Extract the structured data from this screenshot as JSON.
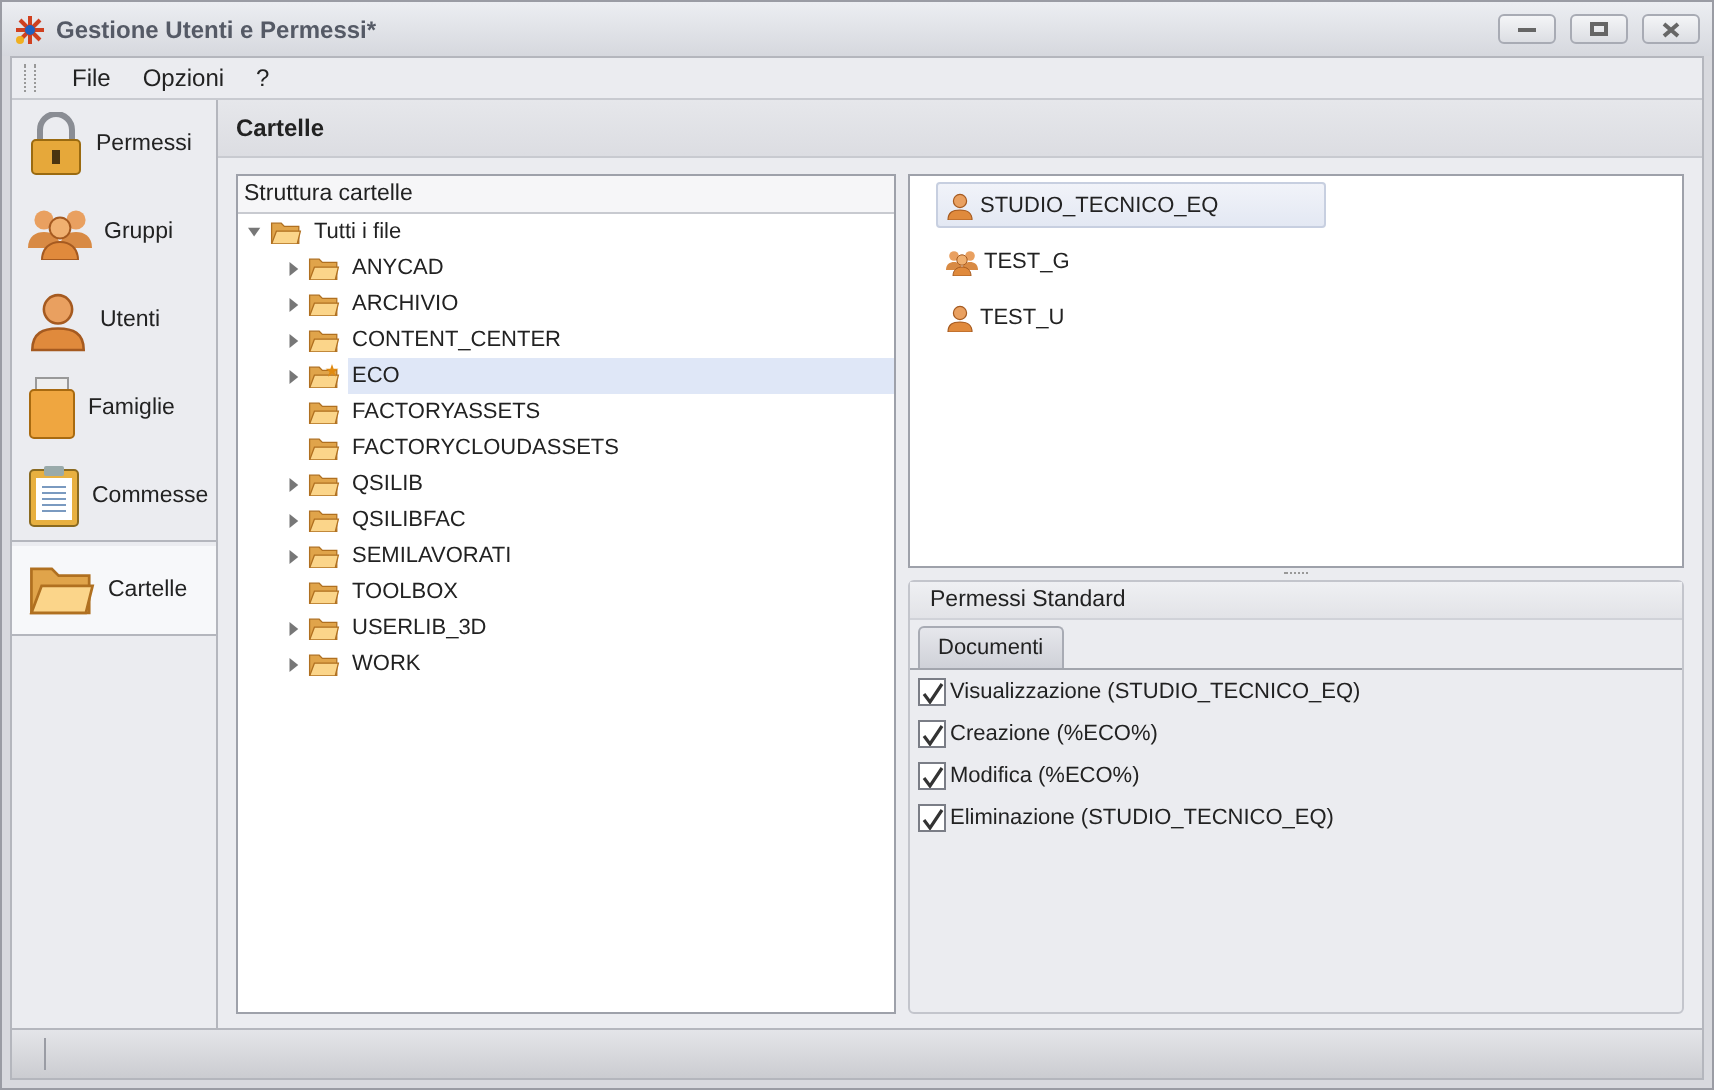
{
  "window": {
    "title": "Gestione Utenti e Permessi*"
  },
  "menu": [
    "File",
    "Opzioni",
    "?"
  ],
  "nav": [
    {
      "label": "Permessi",
      "kind": "lock",
      "selected": false
    },
    {
      "label": "Gruppi",
      "kind": "group",
      "selected": false
    },
    {
      "label": "Utenti",
      "kind": "user",
      "selected": false
    },
    {
      "label": "Famiglie",
      "kind": "box",
      "selected": false
    },
    {
      "label": "Commesse",
      "kind": "clipboard",
      "selected": false
    },
    {
      "label": "Cartelle",
      "kind": "folder",
      "selected": true
    }
  ],
  "content_title": "Cartelle",
  "tree": {
    "title": "Struttura cartelle",
    "root": {
      "label": "Tutti i file",
      "expanded": true,
      "children": [
        {
          "label": "ANYCAD",
          "expandable": true,
          "selected": false,
          "shared": false
        },
        {
          "label": "ARCHIVIO",
          "expandable": true,
          "selected": false,
          "shared": false
        },
        {
          "label": "CONTENT_CENTER",
          "expandable": true,
          "selected": false,
          "shared": false
        },
        {
          "label": "ECO",
          "expandable": true,
          "selected": true,
          "shared": true
        },
        {
          "label": "FACTORYASSETS",
          "expandable": false,
          "selected": false,
          "shared": false
        },
        {
          "label": "FACTORYCLOUDASSETS",
          "expandable": false,
          "selected": false,
          "shared": false
        },
        {
          "label": "QSILIB",
          "expandable": true,
          "selected": false,
          "shared": false
        },
        {
          "label": "QSILIBFAC",
          "expandable": true,
          "selected": false,
          "shared": false
        },
        {
          "label": "SEMILAVORATI",
          "expandable": true,
          "selected": false,
          "shared": false
        },
        {
          "label": "TOOLBOX",
          "expandable": false,
          "selected": false,
          "shared": false
        },
        {
          "label": "USERLIB_3D",
          "expandable": true,
          "selected": false,
          "shared": false
        },
        {
          "label": "WORK",
          "expandable": true,
          "selected": false,
          "shared": false
        }
      ]
    }
  },
  "principals": [
    {
      "label": "STUDIO_TECNICO_EQ",
      "kind": "user",
      "selected": true
    },
    {
      "label": "TEST_G",
      "kind": "group",
      "selected": false
    },
    {
      "label": "TEST_U",
      "kind": "user",
      "selected": false
    }
  ],
  "permissions": {
    "title": "Permessi Standard",
    "tabs": [
      {
        "label": "Documenti",
        "selected": true
      }
    ],
    "items": [
      {
        "label": "Visualizzazione (STUDIO_TECNICO_EQ)",
        "checked": true
      },
      {
        "label": "Creazione (%ECO%)",
        "checked": true
      },
      {
        "label": "Modifica (%ECO%)",
        "checked": true
      },
      {
        "label": "Eliminazione (STUDIO_TECNICO_EQ)",
        "checked": true
      }
    ]
  }
}
